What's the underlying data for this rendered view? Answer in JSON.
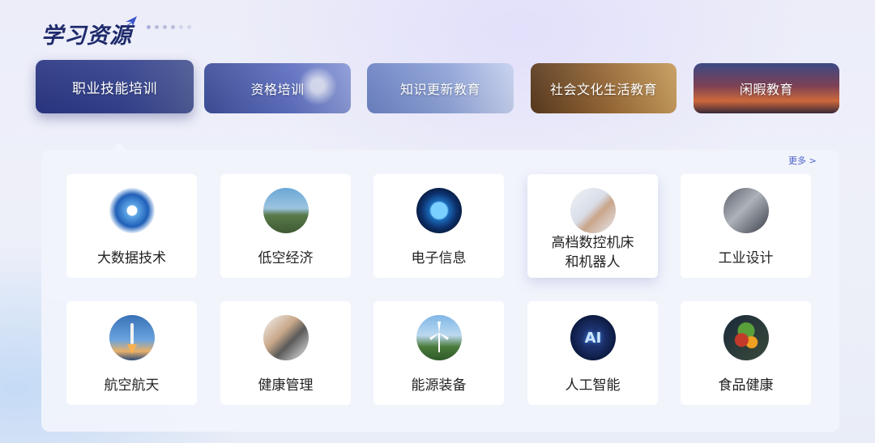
{
  "page": {
    "title": "学习资源"
  },
  "tabs": [
    {
      "label": "职业技能培训",
      "active": true
    },
    {
      "label": "资格培训",
      "active": false
    },
    {
      "label": "知识更新教育",
      "active": false
    },
    {
      "label": "社会文化生活教育",
      "active": false
    },
    {
      "label": "闲暇教育",
      "active": false
    }
  ],
  "panel": {
    "more_label": "更多 >",
    "cards": [
      {
        "label": "大数据技术",
        "icon": "big-data-icon"
      },
      {
        "label": "低空经济",
        "icon": "drone-icon"
      },
      {
        "label": "电子信息",
        "icon": "chip-icon"
      },
      {
        "label": "高档数控机床和机器人",
        "line1": "高档数控机床",
        "line2": "和机器人",
        "icon": "robot-arm-icon"
      },
      {
        "label": "工业设计",
        "icon": "industrial-design-icon"
      },
      {
        "label": "航空航天",
        "icon": "rocket-icon"
      },
      {
        "label": "健康管理",
        "icon": "health-icon"
      },
      {
        "label": "能源装备",
        "icon": "wind-turbine-icon"
      },
      {
        "label": "人工智能",
        "icon": "ai-icon",
        "icon_text": "AI"
      },
      {
        "label": "食品健康",
        "icon": "vegetables-icon"
      }
    ]
  },
  "colors": {
    "title": "#1e2a6b",
    "accent": "#4a62c4",
    "panel_bg": "#f2f4fc"
  }
}
